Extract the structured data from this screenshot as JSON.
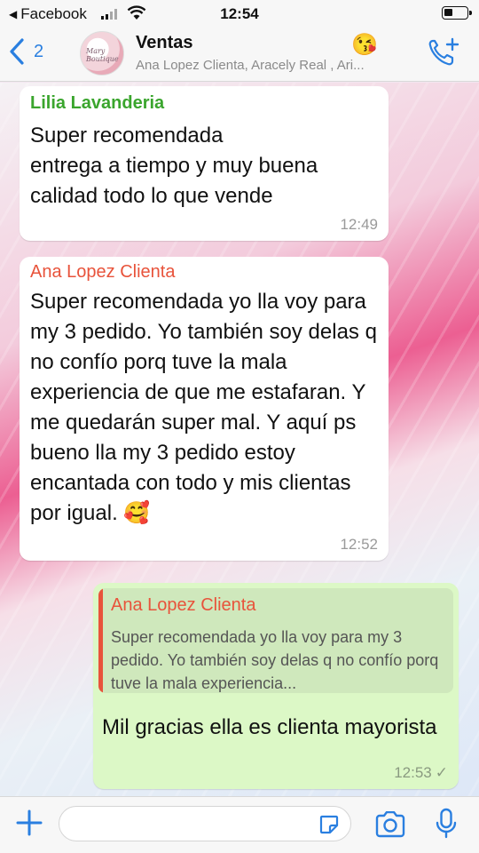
{
  "status_bar": {
    "back_app": "Facebook",
    "time": "12:54"
  },
  "header": {
    "back_count": "2",
    "title": "Ventas",
    "subtitle": "Ana Lopez Clienta, Aracely Real , Ari...",
    "emoji": "😘",
    "avatar_text": "Mary Boutique"
  },
  "messages": [
    {
      "sender": "Lilia Lavanderia",
      "text": "Super recomendada\nentrega a tiempo y muy buena calidad  todo lo que vende",
      "time": "12:49"
    },
    {
      "sender": "Ana Lopez Clienta",
      "text": "Super recomendada yo lla voy para my 3 pedido. Yo también soy delas q no confío porq tuve la mala experiencia de que me estafaran. Y me quedarán super mal. Y aquí ps bueno lla my 3 pedido estoy encantada con todo y mis clientas por igual. 🥰",
      "time": "12:52"
    },
    {
      "quote_sender": "Ana Lopez Clienta",
      "quote_text": "Super recomendada yo lla voy para my 3 pedido. Yo también soy delas q no confío porq tuve la mala experiencia...",
      "text": "Mil gracias ella es clienta mayorista",
      "time": "12:53",
      "status_icon": "✓"
    }
  ],
  "colors": {
    "sender_green": "#3aa52d",
    "sender_red": "#e8533b",
    "outgoing_bubble": "#dcf8c6",
    "ios_blue": "#2a7fe0"
  },
  "icons": [
    "back-chevron-icon",
    "call-add-icon",
    "plus-icon",
    "sticker-icon",
    "camera-icon",
    "mic-icon",
    "wifi-icon",
    "signal-icon",
    "battery-icon"
  ]
}
